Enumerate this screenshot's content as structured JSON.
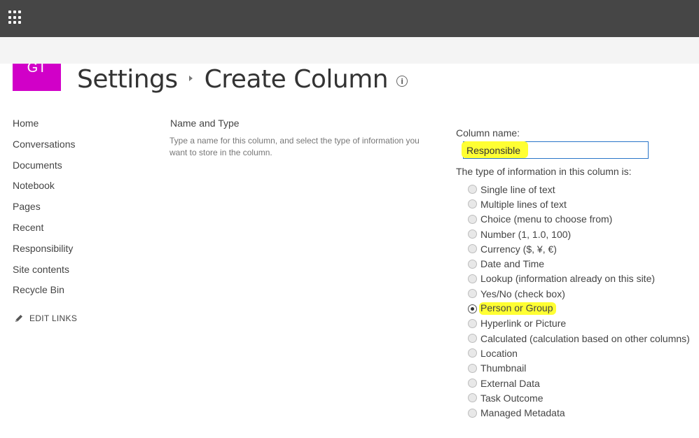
{
  "suite_bar": {
    "app_launcher_icon": "waffle-icon"
  },
  "site": {
    "logo_text": "GT",
    "logo_color": "#d100c8"
  },
  "breadcrumb": {
    "parent": "Settings",
    "current": "Create Column",
    "separator_icon": "chevron-right-icon",
    "info_icon": "info-icon"
  },
  "left_nav": {
    "items": [
      "Home",
      "Conversations",
      "Documents",
      "Notebook",
      "Pages",
      "Recent",
      "Responsibility",
      "Site contents",
      "Recycle Bin"
    ],
    "edit_links_label": "EDIT LINKS",
    "edit_links_icon": "pencil-icon"
  },
  "section": {
    "title": "Name and Type",
    "description": "Type a name for this column, and select the type of information you want to store in the column."
  },
  "form": {
    "column_name_label": "Column name:",
    "column_name_value": "Responsible",
    "type_label": "The type of information in this column is:",
    "types": [
      "Single line of text",
      "Multiple lines of text",
      "Choice (menu to choose from)",
      "Number (1, 1.0, 100)",
      "Currency ($, ¥, €)",
      "Date and Time",
      "Lookup (information already on this site)",
      "Yes/No (check box)",
      "Person or Group",
      "Hyperlink or Picture",
      "Calculated (calculation based on other columns)",
      "Location",
      "Thumbnail",
      "External Data",
      "Task Outcome",
      "Managed Metadata"
    ],
    "selected_type": "Person or Group",
    "highlight_color": "#ffff33",
    "input_border_color": "#2a76c9"
  }
}
